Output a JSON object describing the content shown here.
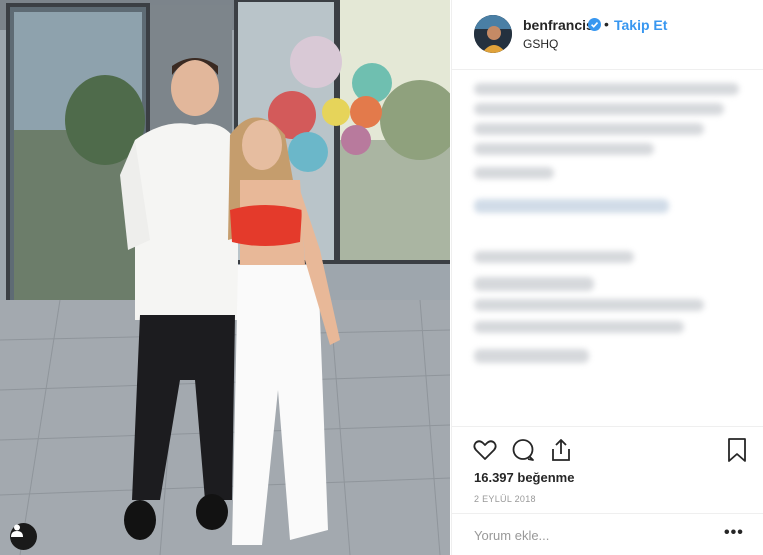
{
  "post": {
    "username": "benfrancis",
    "separator": "•",
    "follow_label": "Takip Et",
    "location": "GSHQ",
    "likes": "16.397 beğenme",
    "date": "2 EYLÜL 2018",
    "comment_placeholder": "Yorum ekle...",
    "more_label": "•••"
  },
  "colors": {
    "follow": "#3897f0",
    "verified": "#3897f0",
    "text": "#262626",
    "muted": "#999999",
    "divider": "#efefef"
  },
  "icons": {
    "header": [
      "verified-badge-icon"
    ],
    "actions": [
      "heart-icon",
      "comment-icon",
      "share-icon",
      "bookmark-icon"
    ],
    "photo": [
      "user-tag-icon"
    ]
  }
}
